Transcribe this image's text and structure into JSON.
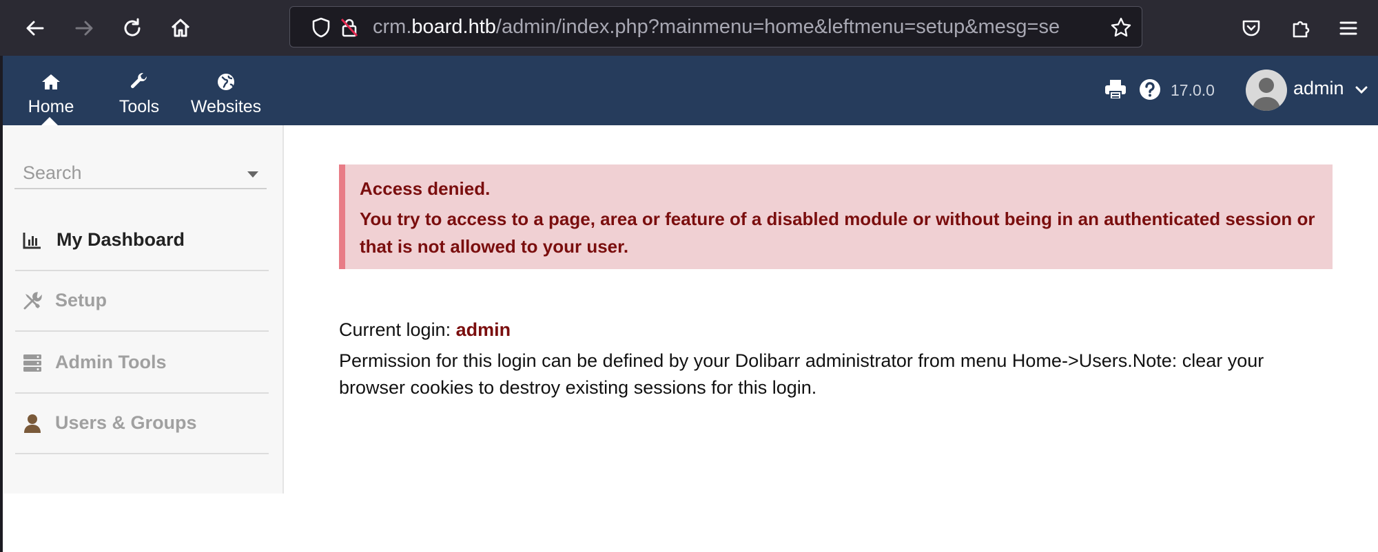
{
  "browser": {
    "url_host_prefix": "crm.",
    "url_host_main": "board.htb",
    "url_path": "/admin/index.php?mainmenu=home&leftmenu=setup&mesg=se"
  },
  "topmenu": {
    "items": [
      {
        "label": "Home",
        "icon": "home-icon"
      },
      {
        "label": "Tools",
        "icon": "wrench-icon"
      },
      {
        "label": "Websites",
        "icon": "globe-icon"
      }
    ],
    "version": "17.0.0",
    "user": "admin"
  },
  "leftmenu": {
    "search_placeholder": "Search",
    "items": [
      {
        "label": "My Dashboard",
        "icon": "chart-icon"
      },
      {
        "label": "Setup",
        "icon": "tools-icon"
      },
      {
        "label": "Admin Tools",
        "icon": "server-icon"
      },
      {
        "label": "Users & Groups",
        "icon": "user-icon"
      }
    ]
  },
  "alert": {
    "title": "Access denied.",
    "message": "You try to access to a page, area or feature of a disabled module or without being in an authenticated session or that is not allowed to your user."
  },
  "login": {
    "label": "Current login:",
    "name": "admin",
    "permission_note": "Permission for this login can be defined by your Dolibarr administrator from menu Home->Users.Note: clear your browser cookies to destroy existing sessions for this login."
  },
  "colors": {
    "topbar": "#263c5c",
    "alert_bg": "#f0d0d3",
    "alert_border": "#e87c86",
    "alert_text": "#7a0e0e"
  }
}
